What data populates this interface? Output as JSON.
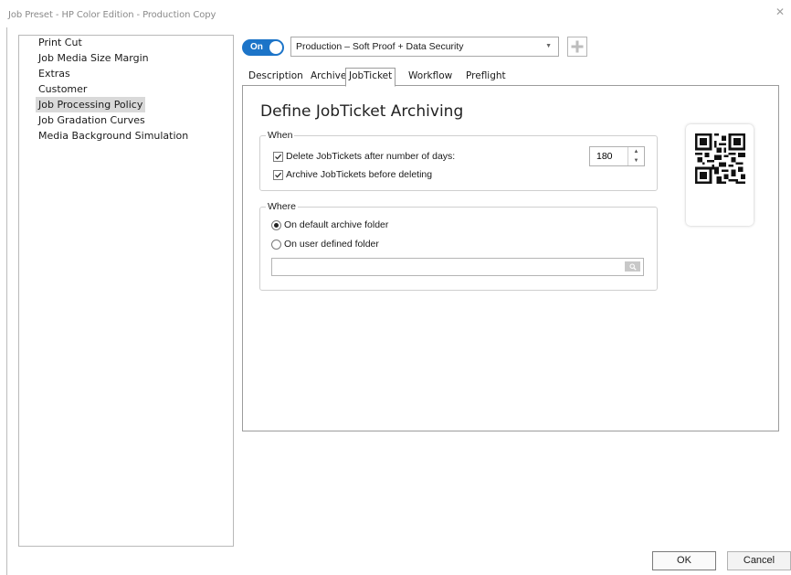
{
  "window": {
    "title": "Job Preset - HP Color Edition - Production Copy"
  },
  "nav": {
    "items": [
      {
        "label": "Print Cut"
      },
      {
        "label": "Job Media Size Margin"
      },
      {
        "label": "Extras"
      },
      {
        "label": "Customer"
      },
      {
        "label": "Job Processing Policy",
        "selected": true
      },
      {
        "label": "Job Gradation Curves"
      },
      {
        "label": "Media Background Simulation"
      }
    ]
  },
  "toolbar": {
    "toggle_label": "On",
    "toggle_state": true,
    "preset_value": "Production – Soft Proof + Data Security"
  },
  "tabs": [
    {
      "label": "Description"
    },
    {
      "label": "Archive"
    },
    {
      "label": "JobTicket",
      "active": true
    },
    {
      "label": "Workflow"
    },
    {
      "label": "Preflight"
    }
  ],
  "content": {
    "title": "Define JobTicket Archiving",
    "when": {
      "legend": "When",
      "delete_label": "Delete JobTickets after number of days:",
      "delete_checked": true,
      "days_value": "180",
      "archive_label": "Archive JobTickets before deleting",
      "archive_checked": true
    },
    "where": {
      "legend": "Where",
      "default_label": "On default archive folder",
      "user_label": "On user defined folder",
      "selected": "default",
      "path_value": ""
    }
  },
  "footer": {
    "ok_label": "OK",
    "cancel_label": "Cancel"
  },
  "colors": {
    "accent": "#1c74c8",
    "selection": "#d9d9d9"
  }
}
